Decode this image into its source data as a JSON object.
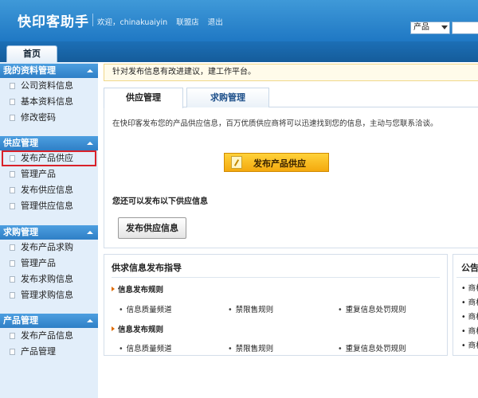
{
  "header": {
    "brand": "快印客助手",
    "welcome": "欢迎，chinakuaiyin",
    "shop_link": "联盟店",
    "logout_link": "退出",
    "search_select_value": "产品",
    "search_placeholder": ""
  },
  "nav": {
    "home_tab": "首页"
  },
  "sidebar": {
    "groups": [
      {
        "title": "我的资料管理",
        "items": [
          "公司资料信息",
          "基本资料信息",
          "修改密码"
        ]
      },
      {
        "title": "供应管理",
        "items": [
          "发布产品供应",
          "管理产品",
          "发布供应信息",
          "管理供应信息"
        ]
      },
      {
        "title": "求购管理",
        "items": [
          "发布产品求购",
          "管理产品",
          "发布求购信息",
          "管理求购信息"
        ]
      },
      {
        "title": "产品管理",
        "items": [
          "发布产品信息",
          "产品管理"
        ]
      }
    ],
    "selected_item": "发布产品供应"
  },
  "notice": "针对发布信息有改进建议，建工作平台。",
  "tabs": {
    "supply": "供应管理",
    "purchase": "求购管理",
    "active": "供应管理"
  },
  "panel": {
    "description": "在快印客发布您的产品供应信息，百万优质供应商将可以迅速找到您的信息，主动与您联系洽谈。",
    "publish_button": "发布产品供应",
    "also_label": "您还可以发布以下供应信息",
    "supply_info_button": "发布供应信息"
  },
  "guide": {
    "title": "供求信息发布指导",
    "sections": [
      {
        "heading": "信息发布规则",
        "links": [
          "信息质量频道",
          "禁限售规则",
          "重复信息处罚规则"
        ]
      },
      {
        "heading": "信息发布规则",
        "links": [
          "信息质量频道",
          "禁限售规则",
          "重复信息处罚规则"
        ]
      }
    ]
  },
  "announcement": {
    "title": "公告",
    "items": [
      "商机",
      "商机",
      "商机",
      "商机",
      "商机"
    ]
  },
  "colors": {
    "header_blue": "#1f78c4",
    "sidebar_bg": "#e2eefa",
    "highlight_red": "#d9222a",
    "publish_yellow": "#f4a90e"
  }
}
